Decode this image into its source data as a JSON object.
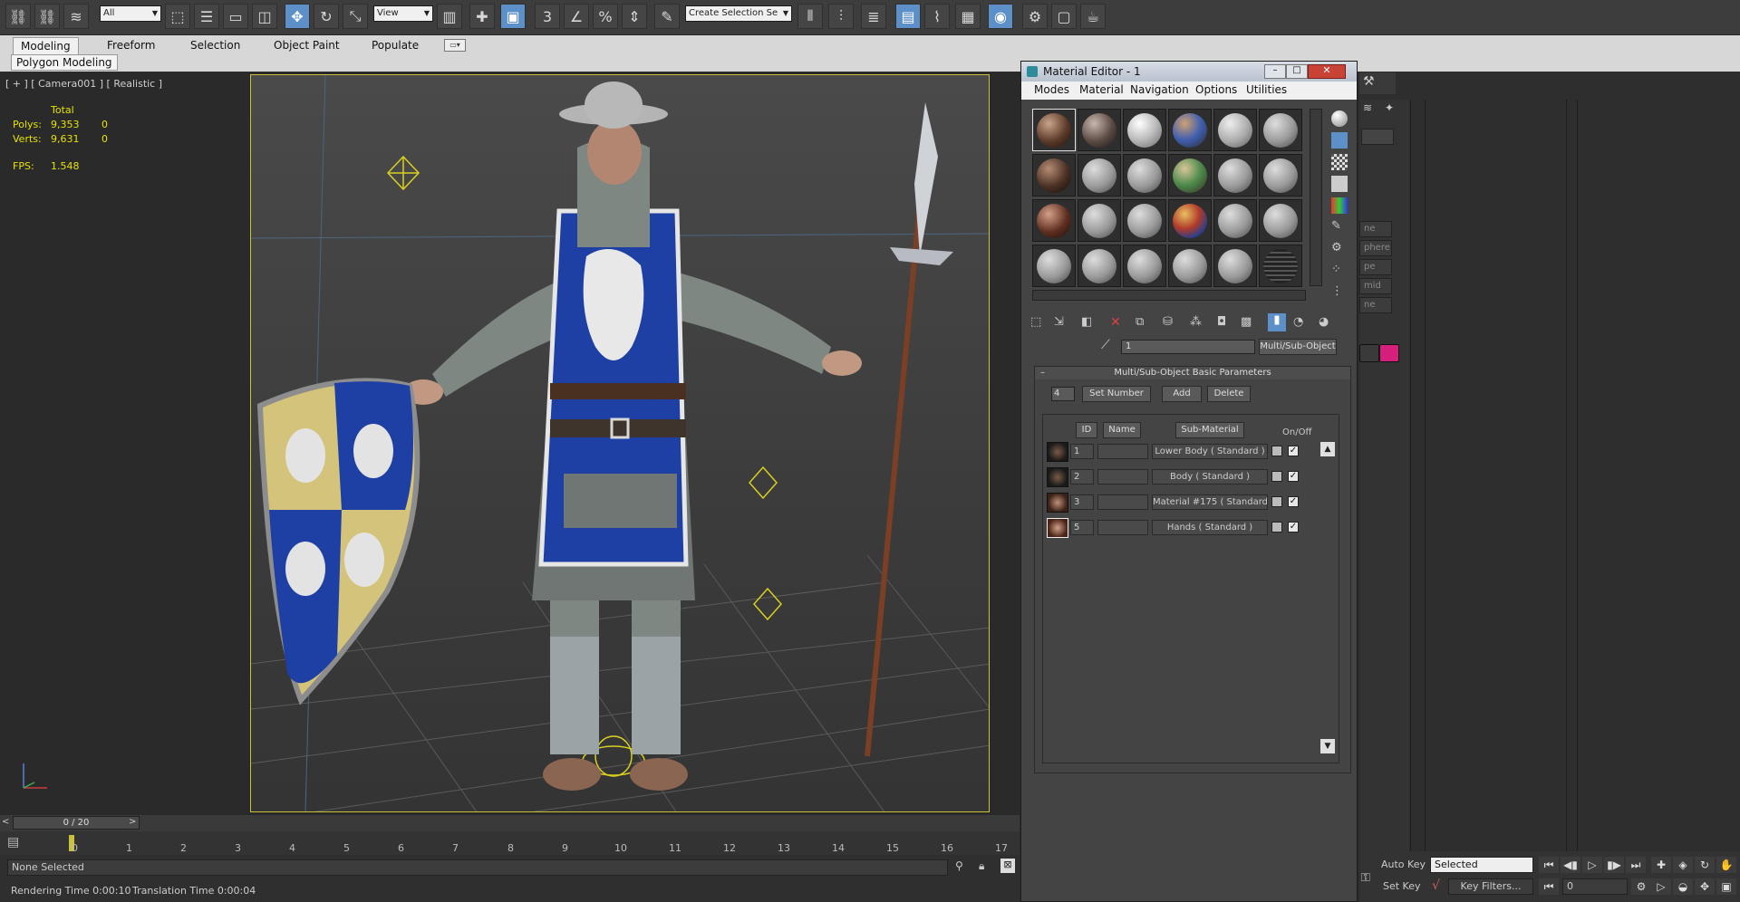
{
  "toolbar": {
    "selection_filter": "All",
    "reference_coord": "View",
    "named_selection_placeholder": "Create Selection Se",
    "snap_label": "3",
    "angle_snap": "",
    "percent_snap": "%"
  },
  "ribbon": {
    "tabs": [
      "Modeling",
      "Freeform",
      "Selection",
      "Object Paint",
      "Populate"
    ],
    "subtab": "Polygon Modeling"
  },
  "viewport": {
    "label": "[ + ] [ Camera001 ] [ Realistic ]",
    "stats": {
      "total_header": "Total",
      "polys_label": "Polys:",
      "polys_total": "9,353",
      "polys_sel": "0",
      "verts_label": "Verts:",
      "verts_total": "9,631",
      "verts_sel": "0",
      "fps_label": "FPS:",
      "fps_value": "1.548"
    }
  },
  "material_editor": {
    "title": "Material Editor - 1",
    "menu": [
      "Modes",
      "Material",
      "Navigation",
      "Options",
      "Utilities"
    ],
    "material_name": "1",
    "material_type": "Multi/Sub-Object",
    "rollout_title": "Multi/Sub-Object Basic Parameters",
    "count": "4",
    "set_number": "Set Number",
    "add": "Add",
    "delete": "Delete",
    "headers": {
      "id": "ID",
      "name": "Name",
      "sub": "Sub-Material",
      "onoff": "On/Off"
    },
    "rows": [
      {
        "id": "1",
        "name": "",
        "sub": "Lower Body  ( Standard )"
      },
      {
        "id": "2",
        "name": "",
        "sub": "Body  ( Standard )"
      },
      {
        "id": "3",
        "name": "",
        "sub": "Material #175  ( Standard )"
      },
      {
        "id": "5",
        "name": "",
        "sub": "Hands  ( Standard )"
      }
    ]
  },
  "right_panel": {
    "partial_items": [
      "ne",
      "phere",
      "pe",
      "mid",
      "ne"
    ]
  },
  "timeline": {
    "frame_display": "0 / 20",
    "ticks": [
      "0",
      "1",
      "2",
      "3",
      "4",
      "5",
      "6",
      "7",
      "8",
      "9",
      "10",
      "11",
      "12",
      "13",
      "14",
      "15",
      "16",
      "17"
    ]
  },
  "status": {
    "selection": "None Selected",
    "rendering_time": "Rendering Time  0:00:10",
    "translation_time": "Translation Time  0:00:04",
    "auto_key": "Auto Key",
    "set_key": "Set Key",
    "key_mode": "Selected",
    "key_filters": "Key Filters...",
    "current_frame": "0"
  },
  "colors": {
    "accent_blue": "#5d8fc9",
    "viewport_border": "#c9c23a",
    "stats_yellow": "#e6e200",
    "swatch_pink": "#d61f7a"
  }
}
